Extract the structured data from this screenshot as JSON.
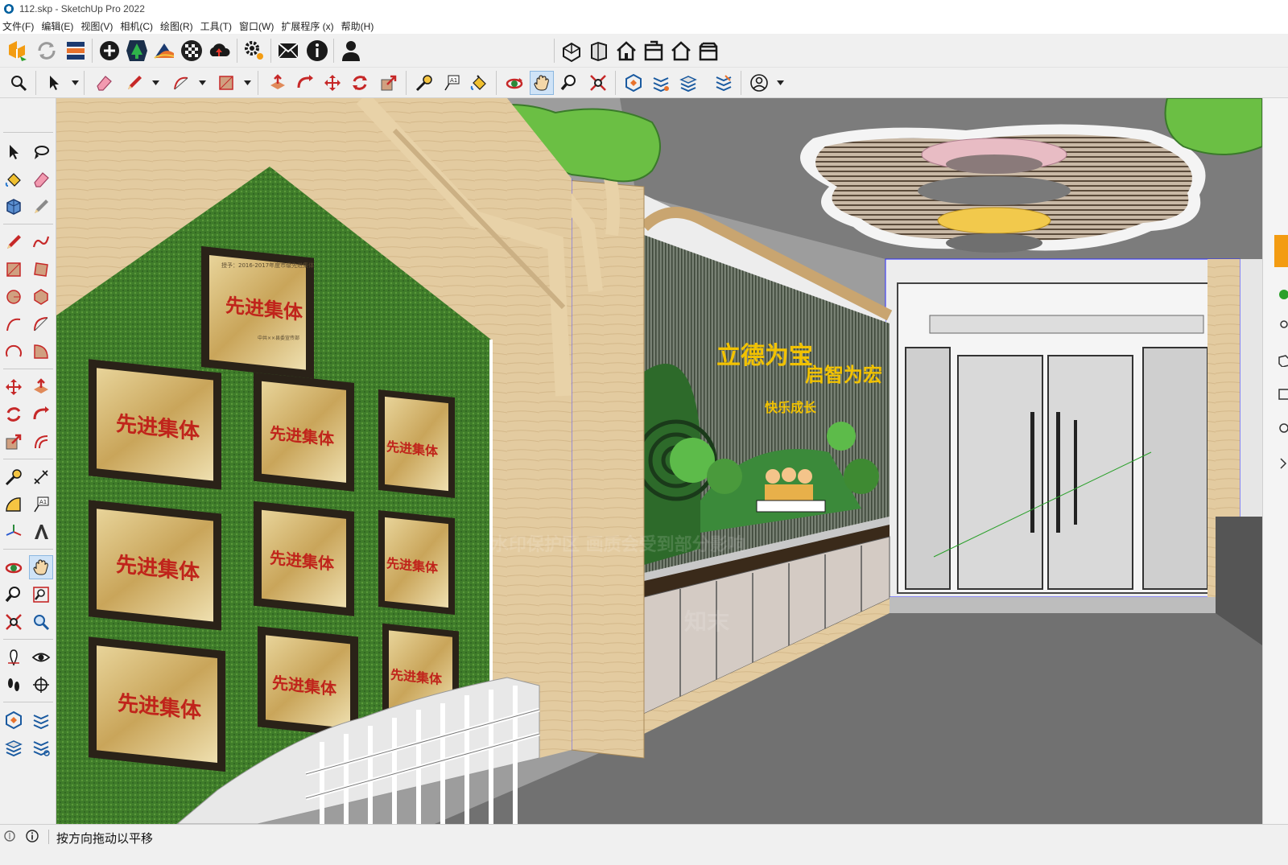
{
  "window": {
    "title": "112.skp - SketchUp Pro 2022"
  },
  "menu": [
    {
      "id": "file",
      "label": "文件(F)"
    },
    {
      "id": "edit",
      "label": "编辑(E)"
    },
    {
      "id": "view",
      "label": "视图(V)"
    },
    {
      "id": "camera",
      "label": "相机(C)"
    },
    {
      "id": "draw",
      "label": "绘图(R)"
    },
    {
      "id": "tools",
      "label": "工具(T)"
    },
    {
      "id": "window",
      "label": "窗口(W)"
    },
    {
      "id": "extensions",
      "label": "扩展程序 (x)"
    },
    {
      "id": "help",
      "label": "帮助(H)"
    }
  ],
  "icons": {
    "toolbar_top": [
      "warehouse-logo-icon",
      "reload-icon",
      "extension-manager-icon",
      "add-location-icon",
      "tree-icon",
      "sandbox-icon",
      "texture-icon",
      "cloud-upload-icon",
      "gear-settings-icon",
      "mail-icon",
      "info-icon",
      "account-icon"
    ],
    "views": [
      "iso-view-icon",
      "front-view-icon",
      "top-view-icon",
      "right-view-icon",
      "back-view-icon",
      "left-view-icon"
    ],
    "toolbar_main": [
      "zoom-extents-icon",
      "select-icon",
      "eraser-icon",
      "pencil-line-icon",
      "arc-icon",
      "rectangle-icon",
      "push-pull-icon",
      "follow-me-icon",
      "move-icon",
      "rotate-icon",
      "scale-icon",
      "tape-measure-icon",
      "text-label-icon",
      "paint-bucket-icon",
      "orbit-icon",
      "pan-icon",
      "zoom-icon",
      "zoom-window-icon",
      "section-plane-icon",
      "section-display-icon",
      "section-fill-icon",
      "section-cuts-icon",
      "profile-icon"
    ]
  },
  "viewport": {
    "plaque_title": "先进集体",
    "plaque_header": "授予：2016-2017年度市级先进集体",
    "plaque_footer": "中共××县委宣传部",
    "sign_line1": "立德为宝",
    "sign_line2": "启智为宏",
    "sign_sub": "快乐成长",
    "watermark_notice": "水印保护区   画质会受到部分影响",
    "watermark_brand": "知末"
  },
  "status": {
    "hint": "按方向拖动以平移"
  },
  "colors": {
    "accent_orange": "#f39c12",
    "selection_blue": "#cfe3f7",
    "wall_wood": "#e3cba0",
    "grass_green": "#3f7c2a",
    "floor_gray": "#717171",
    "plaque_gold": "#c9a55a",
    "plaque_text_red": "#c0241b"
  }
}
